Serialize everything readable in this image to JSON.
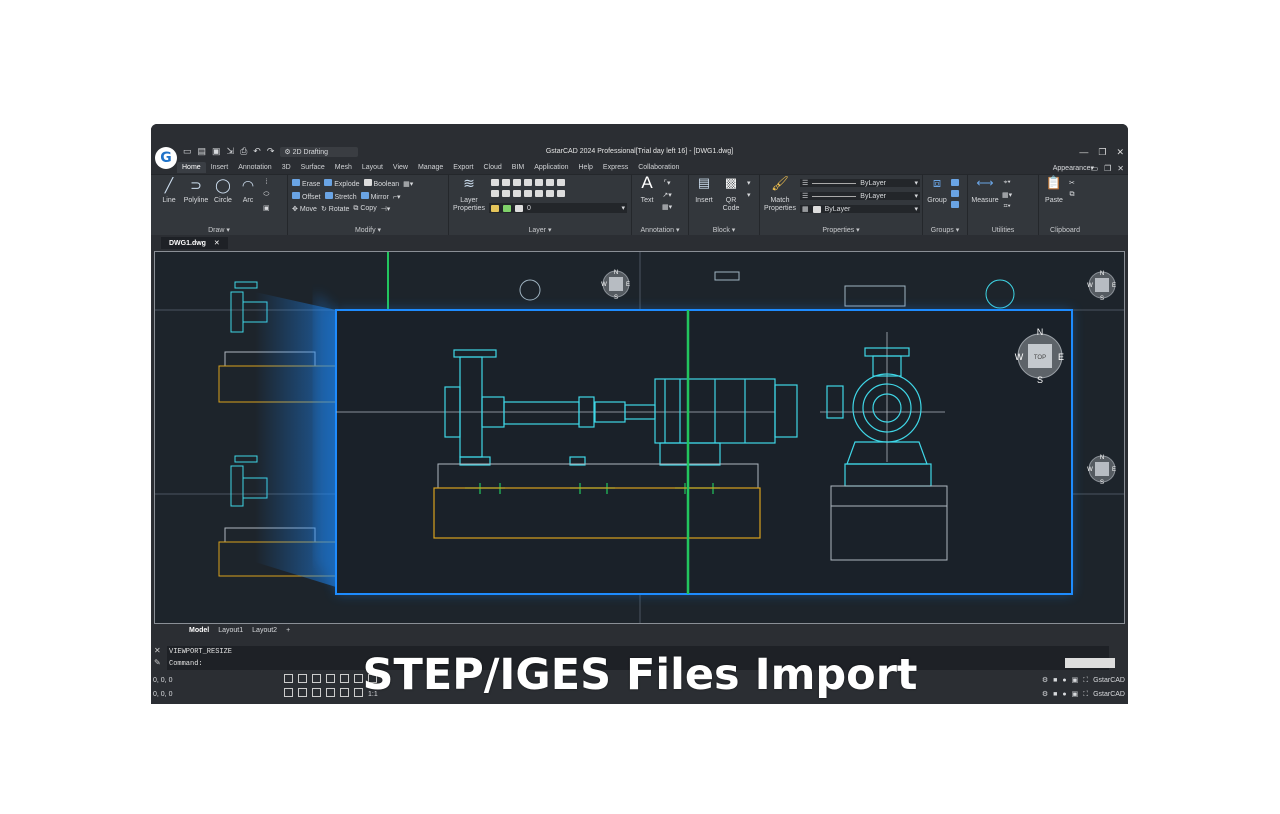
{
  "app": {
    "title": "GstarCAD 2024 Professional[Trial day left 16] - [DWG1.dwg]",
    "logo_letter": "G",
    "workspace": "2D Drafting",
    "appearance": "Appearance"
  },
  "ribbon_tabs": [
    "Home",
    "Insert",
    "Annotation",
    "3D",
    "Surface",
    "Mesh",
    "Layout",
    "View",
    "Manage",
    "Export",
    "Cloud",
    "BIM",
    "Application",
    "Help",
    "Express",
    "Collaboration"
  ],
  "draw": {
    "title": "Draw",
    "tools": [
      "Line",
      "Polyline",
      "Circle",
      "Arc"
    ]
  },
  "modify": {
    "title": "Modify",
    "row1": [
      "Erase",
      "Explode",
      "Boolean"
    ],
    "row2": [
      "Offset",
      "Stretch",
      "Mirror"
    ],
    "row3": [
      "Move",
      "Rotate",
      "Copy"
    ]
  },
  "layer": {
    "title": "Layer",
    "tool": "Layer Properties",
    "current": "0"
  },
  "annotation": {
    "title": "Annotation",
    "tool": "Text"
  },
  "block": {
    "title": "Block",
    "tools": [
      "Insert",
      "QR Code"
    ]
  },
  "properties": {
    "title": "Properties",
    "tool": "Match Properties",
    "bylayer1": "ByLayer",
    "bylayer2": "ByLayer",
    "bylayer3": "ByLayer"
  },
  "groups": {
    "title": "Groups",
    "tool": "Group"
  },
  "utilities": {
    "title": "Utilities",
    "tool": "Measure"
  },
  "clipboard": {
    "title": "Clipboard",
    "tool": "Paste"
  },
  "doc_tab": "DWG1.dwg",
  "layout_tabs": [
    "Model",
    "Layout1",
    "Layout2",
    "+"
  ],
  "command": {
    "history": "VIEWPORT_RESIZE",
    "prompt": "Command:"
  },
  "status": {
    "coords1": "0, 0, 0",
    "coords2": "0, 0, 0",
    "product": "GstarCAD",
    "scale": "1:1"
  },
  "viewcube": {
    "n": "N",
    "s": "S",
    "e": "E",
    "w": "W",
    "top": "TOP"
  },
  "caption": "STEP/IGES Files Import",
  "colors": {
    "accent": "#1e8cff",
    "cad_line": "#3fd6e6",
    "axis": "#22c55e",
    "base": "#d9a21e"
  }
}
